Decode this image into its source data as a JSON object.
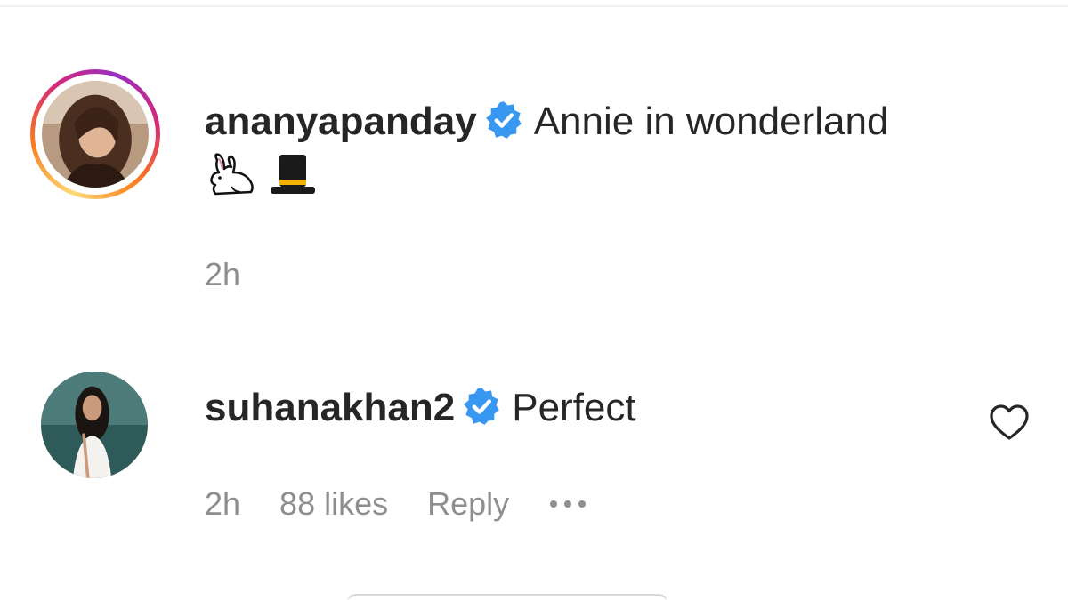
{
  "caption": {
    "username": "ananyapanday",
    "verified": true,
    "text": "Annie in wonderland",
    "emojis": [
      "rabbit-emoji",
      "top-hat-emoji"
    ],
    "time": "2h"
  },
  "comment": {
    "username": "suhanakhan2",
    "verified": true,
    "text": "Perfect",
    "time": "2h",
    "likes": "88 likes",
    "reply_label": "Reply",
    "more_icon": "more-dots-icon",
    "like_icon": "heart-outline-icon"
  },
  "colors": {
    "text": "#262626",
    "muted": "#8e8e8e",
    "verified_blue": "#3897f0",
    "divider": "#efefef"
  }
}
